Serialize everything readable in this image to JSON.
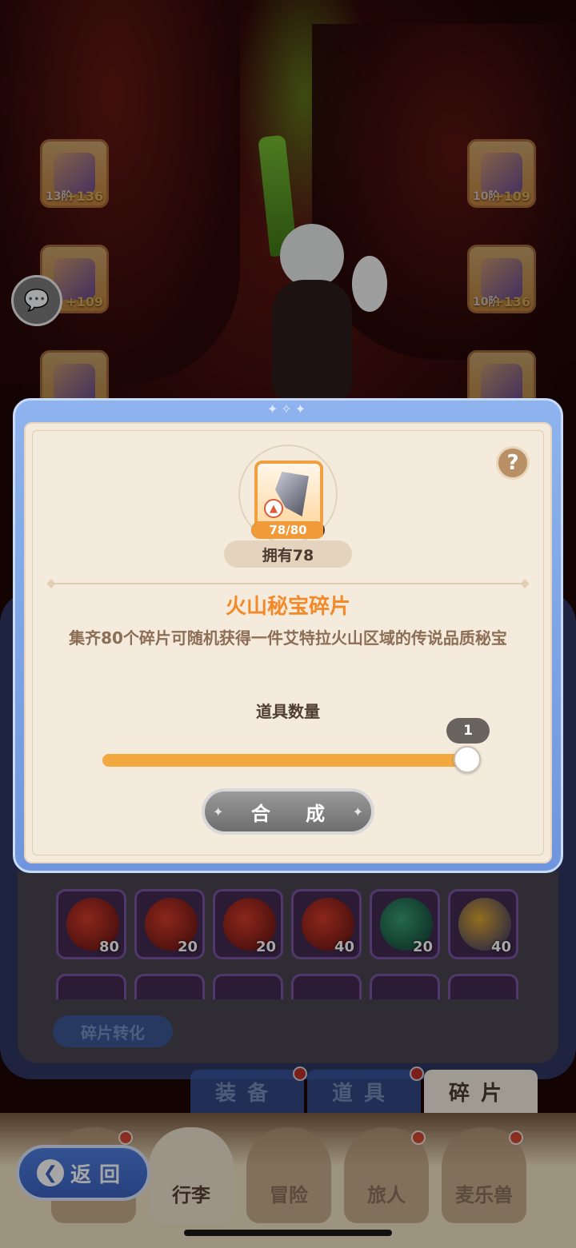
{
  "equipment": [
    {
      "tier": "13阶",
      "bonus": "+136"
    },
    {
      "tier": "",
      "bonus": "+109"
    },
    {
      "tier": "",
      "bonus": ""
    },
    {
      "tier": "10阶",
      "bonus": "+109"
    },
    {
      "tier": "10阶",
      "bonus": "+136"
    },
    {
      "tier": "",
      "bonus": ""
    }
  ],
  "chat": {
    "icon": "chat-bubble-icon"
  },
  "modal": {
    "help_label": "?",
    "item": {
      "count_text": "78/80",
      "progress": 0.975,
      "owned_label": "拥有78",
      "name": "火山秘宝碎片",
      "description": "集齐80个碎片可随机获得一件艾特拉火山区域的传说品质秘宝",
      "icon": "volcano-treasure-shard-icon"
    },
    "quantity": {
      "label": "道具数量",
      "value": "1",
      "slider_fraction": 1.0
    },
    "craft_button": "合 成",
    "ornament": "✦✧✦"
  },
  "fragments": {
    "row1": [
      {
        "count": "80",
        "style": "red"
      },
      {
        "count": "20",
        "style": "red"
      },
      {
        "count": "20",
        "style": "red"
      },
      {
        "count": "40",
        "style": "red"
      },
      {
        "count": "20",
        "style": "green"
      },
      {
        "count": "40",
        "style": "gold"
      }
    ],
    "convert_label": "碎片转化"
  },
  "tabs": [
    {
      "label": "装备",
      "active": false,
      "badge": true
    },
    {
      "label": "道具",
      "active": false,
      "badge": true
    },
    {
      "label": "碎片",
      "active": true,
      "badge": false
    }
  ],
  "bottom_nav": [
    {
      "label": "",
      "badge": true
    },
    {
      "label": "行李",
      "badge": false
    },
    {
      "label": "冒险",
      "badge": false
    },
    {
      "label": "旅人",
      "badge": true
    },
    {
      "label": "麦乐兽",
      "badge": true
    }
  ],
  "back_button": {
    "label": "返回",
    "icon": "chevron-left-icon"
  },
  "colors": {
    "accent_orange": "#f2892a",
    "modal_bg": "#f4ebdc",
    "frame_blue": "#6f95de"
  }
}
